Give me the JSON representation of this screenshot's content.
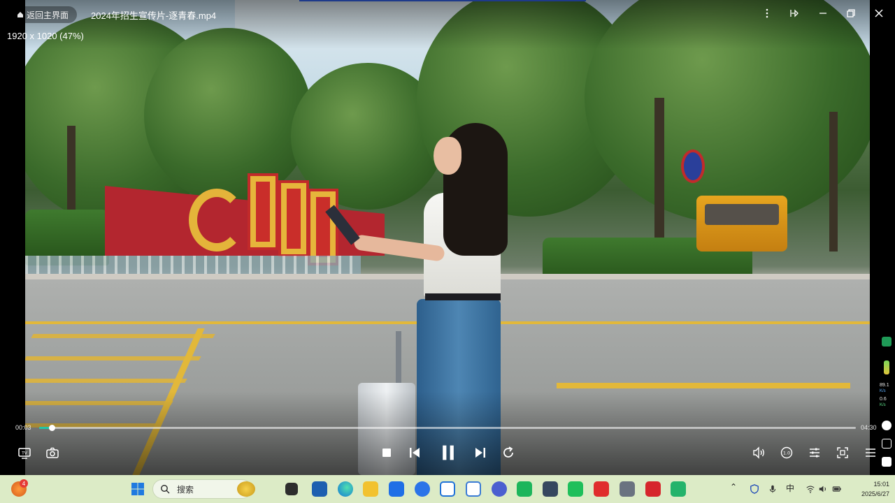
{
  "player": {
    "home_label": "返回主界面",
    "file_name": "2024年招生宣传片-逐青春.mp4",
    "resolution": "1920 x 1020 (47%)",
    "current_time": "00:03",
    "total_time": "04:30",
    "progress_fraction": 0.0155
  },
  "window_controls": {
    "icons": [
      "more-icon",
      "pin-icon",
      "minimize-icon",
      "restore-icon",
      "close-icon"
    ]
  },
  "player_controls": {
    "left": [
      "tv-icon",
      "screenshot-icon"
    ],
    "center": [
      "stop-icon",
      "previous-icon",
      "pause-icon",
      "next-icon",
      "loop-icon"
    ],
    "right": [
      "volume-icon",
      "speed-icon",
      "settings-icon",
      "fullscreen-icon",
      "playlist-icon"
    ]
  },
  "side_monitor": {
    "up_value": "89.1",
    "up_unit": "K/s",
    "down_value": "0.6",
    "down_unit": "K/s"
  },
  "taskbar": {
    "notification_count": "4",
    "search_placeholder": "搜索",
    "ime": "中",
    "time": "15:01",
    "date": "2025/6/27"
  },
  "colors": {
    "progress_accent": "#22c5a6",
    "taskbar_bg": "#dcebc6"
  }
}
